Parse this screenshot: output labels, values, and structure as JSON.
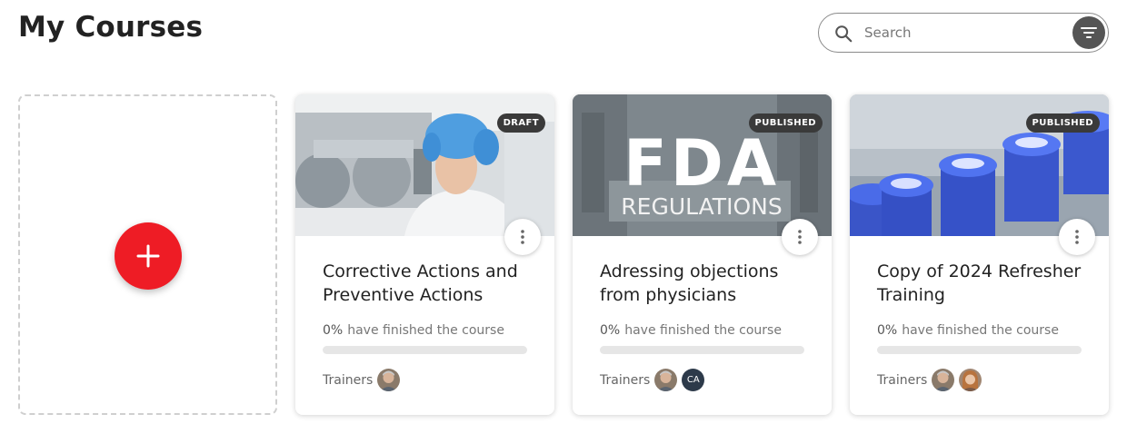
{
  "header": {
    "title": "My Courses"
  },
  "search": {
    "placeholder": "Search"
  },
  "courses": [
    {
      "title": "Corrective Actions and Preventive Actions",
      "status": "DRAFT",
      "progress_pct": "0%",
      "progress_value": 0,
      "progress_label": "have finished the course",
      "trainers_label": "Trainers"
    },
    {
      "title": "Adressing objections from physicians",
      "status": "PUBLISHED",
      "progress_pct": "0%",
      "progress_value": 0,
      "progress_label": "have finished the course",
      "trainers_label": "Trainers",
      "thumb_text_1": "FDA",
      "thumb_text_2": "REGULATIONS",
      "trainer_initials": "CA"
    },
    {
      "title": "Copy of 2024 Refresher Training",
      "status": "PUBLISHED",
      "progress_pct": "0%",
      "progress_value": 0,
      "progress_label": "have finished the course",
      "trainers_label": "Trainers"
    }
  ],
  "colors": {
    "add_button": "#ee1c25",
    "badge": "#3a3a3a",
    "filter_button": "#555555"
  }
}
